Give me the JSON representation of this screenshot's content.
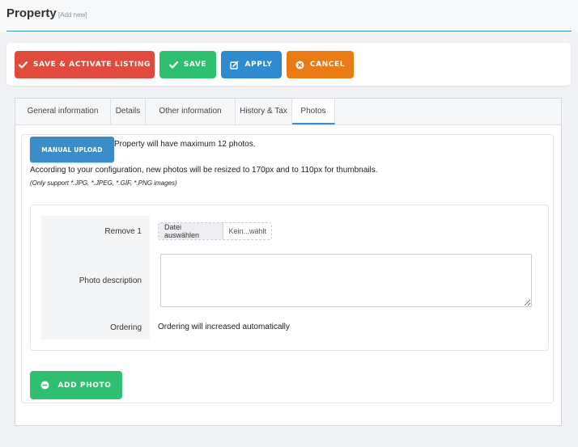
{
  "page": {
    "title": "Property",
    "subtitle": "[Add new]"
  },
  "toolbar": {
    "save_activate_label": "SAVE & ACTIVATE LISTING",
    "save_label": "SAVE",
    "apply_label": "APPLY",
    "cancel_label": "CANCEL",
    "colors": {
      "save_activate": "#e04b3e",
      "save": "#2fbf71",
      "apply": "#2e8bd0",
      "cancel": "#ea7a14"
    }
  },
  "tabs": [
    {
      "label": "General information"
    },
    {
      "label": "Details"
    },
    {
      "label": "Other information"
    },
    {
      "label": "History & Tax"
    },
    {
      "label": "Photos",
      "active": true
    }
  ],
  "photos": {
    "upload_button": "MANUAL UPLOAD",
    "max_text": "Property will have maximum 12 photos.",
    "resize_text": "According to your configuration, new photos will be resized to 170px and to 110px for thumbnails.",
    "support_text": "(Only support *.JPG, *.JPEG, *.GIF, *.PNG images)",
    "form": {
      "remove_label": "Remove 1",
      "file_button": "Datei auswählen",
      "file_status": "Kein...wählt",
      "description_label": "Photo description",
      "description_value": "",
      "ordering_label": "Ordering",
      "ordering_text": "Ordering will increased automatically"
    },
    "add_button": "ADD PHOTO"
  },
  "icons": {
    "save_activate": "check-icon",
    "save": "check-icon",
    "apply": "edit-icon",
    "cancel": "close-circle-icon",
    "add": "minus-circle-icon"
  }
}
